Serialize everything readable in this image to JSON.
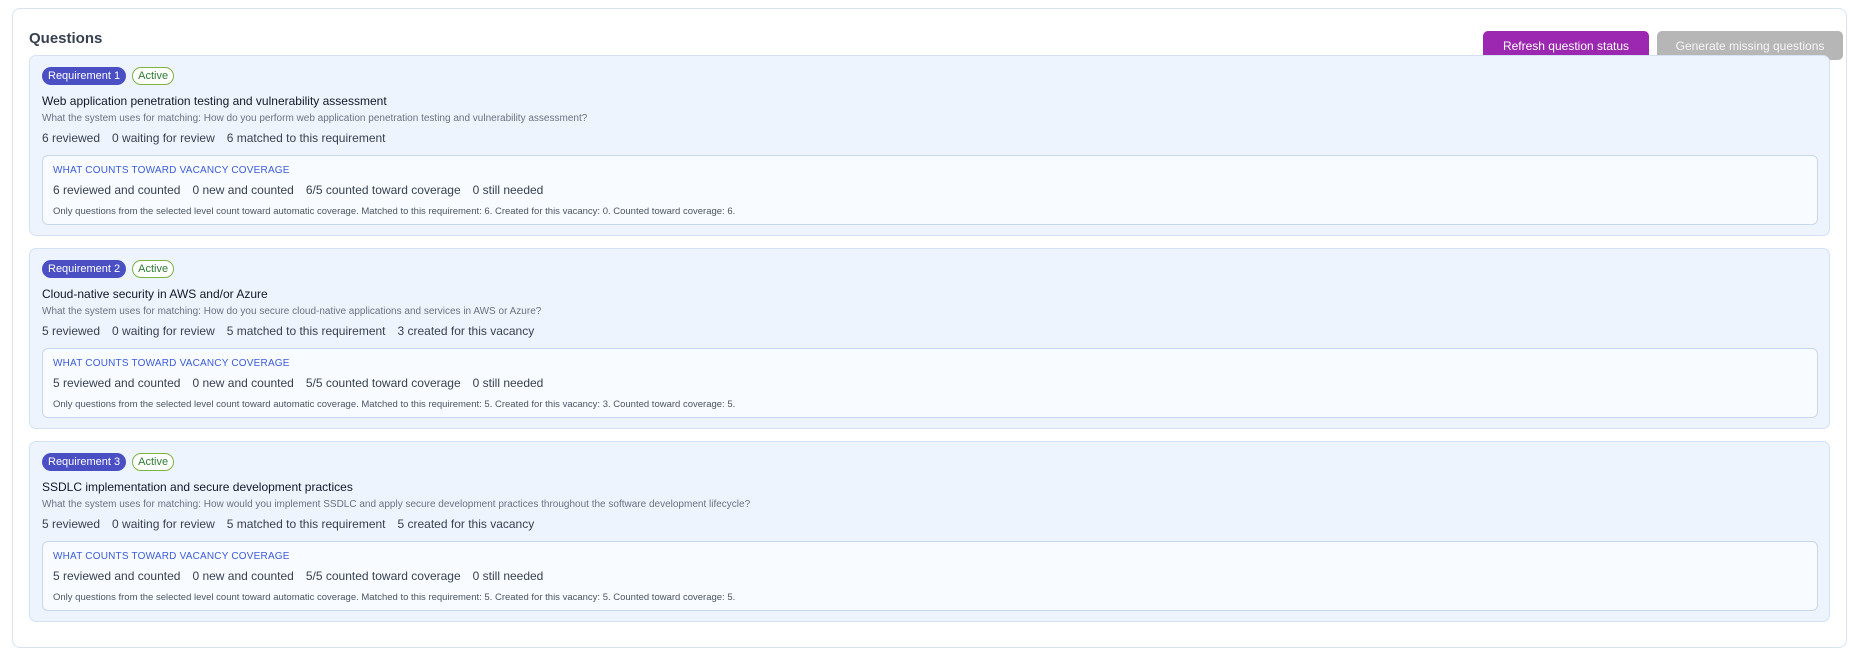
{
  "header": {
    "title": "Questions",
    "refresh_label": "Refresh question status",
    "generate_label": "Generate missing questions",
    "accent_color": "#9c27b0"
  },
  "requirements": [
    {
      "badge": "Requirement 1",
      "status": "Active",
      "title": "Web application penetration testing and vulnerability assessment",
      "matching": "What the system uses for matching: How do you perform web application penetration testing and vulnerability assessment?",
      "stats": [
        "6 reviewed",
        "0 waiting for review",
        "6 matched to this requirement"
      ],
      "coverage": {
        "title": "WHAT COUNTS TOWARD VACANCY COVERAGE",
        "stats": [
          "6 reviewed and counted",
          "0 new and counted",
          "6/5 counted toward coverage",
          "0 still needed"
        ],
        "note": "Only questions from the selected level count toward automatic coverage. Matched to this requirement: 6. Created for this vacancy: 0. Counted toward coverage: 6."
      }
    },
    {
      "badge": "Requirement 2",
      "status": "Active",
      "title": "Cloud-native security in AWS and/or Azure",
      "matching": "What the system uses for matching: How do you secure cloud-native applications and services in AWS or Azure?",
      "stats": [
        "5 reviewed",
        "0 waiting for review",
        "5 matched to this requirement",
        "3 created for this vacancy"
      ],
      "coverage": {
        "title": "WHAT COUNTS TOWARD VACANCY COVERAGE",
        "stats": [
          "5 reviewed and counted",
          "0 new and counted",
          "5/5 counted toward coverage",
          "0 still needed"
        ],
        "note": "Only questions from the selected level count toward automatic coverage. Matched to this requirement: 5. Created for this vacancy: 3. Counted toward coverage: 5."
      }
    },
    {
      "badge": "Requirement 3",
      "status": "Active",
      "title": "SSDLC implementation and secure development practices",
      "matching": "What the system uses for matching: How would you implement SSDLC and apply secure development practices throughout the software development lifecycle?",
      "stats": [
        "5 reviewed",
        "0 waiting for review",
        "5 matched to this requirement",
        "5 created for this vacancy"
      ],
      "coverage": {
        "title": "WHAT COUNTS TOWARD VACANCY COVERAGE",
        "stats": [
          "5 reviewed and counted",
          "0 new and counted",
          "5/5 counted toward coverage",
          "0 still needed"
        ],
        "note": "Only questions from the selected level count toward automatic coverage. Matched to this requirement: 5. Created for this vacancy: 5. Counted toward coverage: 5."
      }
    }
  ]
}
